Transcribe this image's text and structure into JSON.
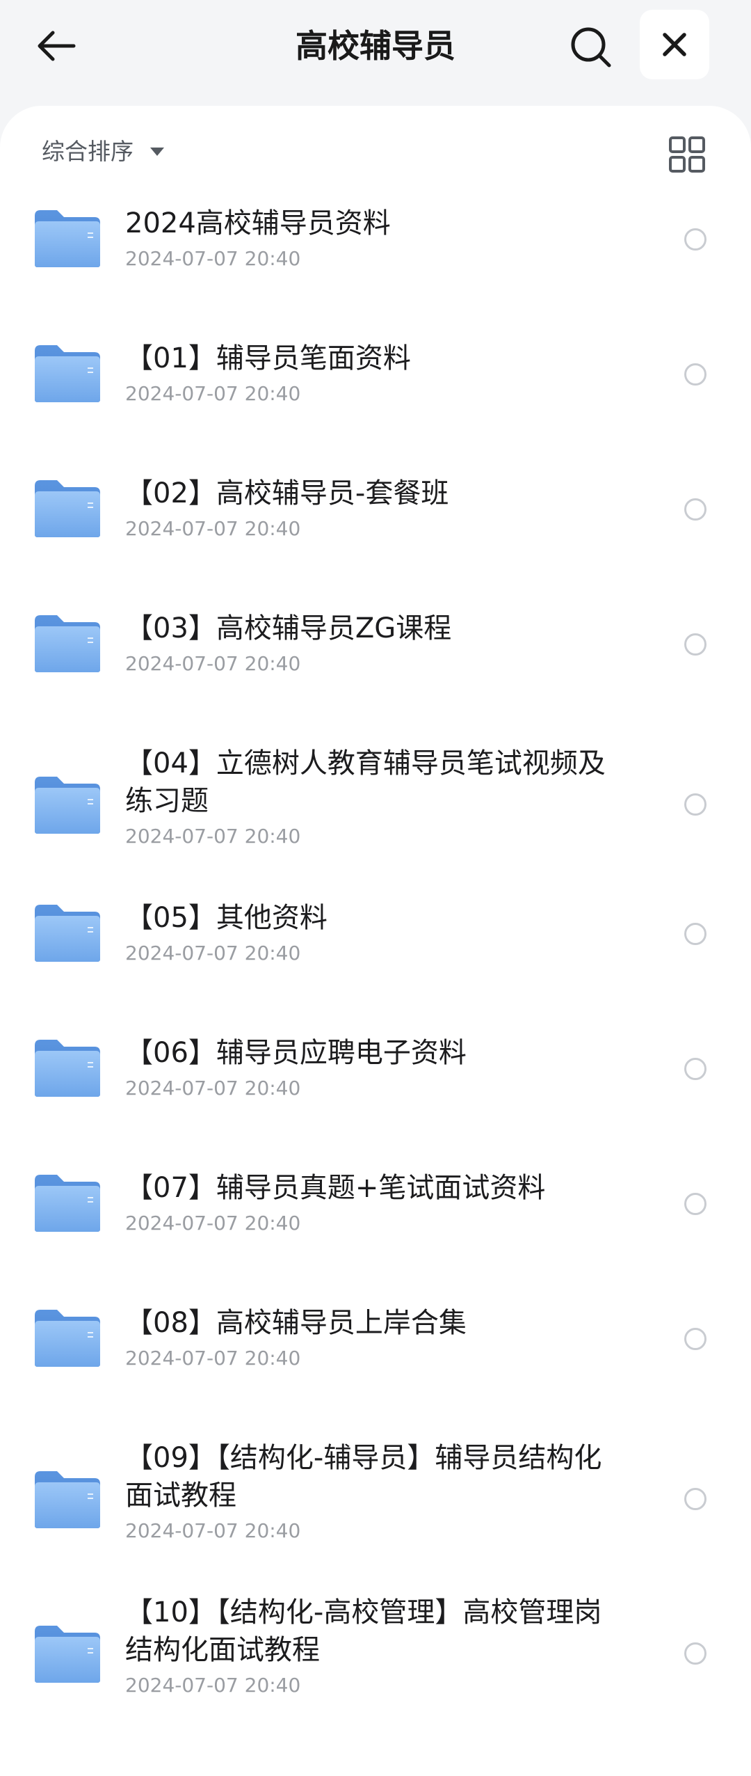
{
  "header": {
    "title": "高校辅导员",
    "back_icon": "arrow-left-icon",
    "search_icon": "search-icon",
    "close_icon": "close-icon"
  },
  "toolbar": {
    "sort_label": "综合排序",
    "sort_icon": "caret-down-icon",
    "view_icon": "grid-view-icon"
  },
  "colors": {
    "background": "#f4f5f7",
    "panel": "#ffffff",
    "folder": "#7fb3ef",
    "date_text": "#9a9da2"
  },
  "files": [
    {
      "name": "2024高校辅导员资料",
      "date": "2024-07-07 20:40"
    },
    {
      "name": "【01】辅导员笔面资料",
      "date": "2024-07-07 20:40"
    },
    {
      "name": "【02】高校辅导员-套餐班",
      "date": "2024-07-07 20:40"
    },
    {
      "name": "【03】高校辅导员ZG课程",
      "date": "2024-07-07 20:40"
    },
    {
      "name": "【04】立德树人教育辅导员笔试视频及练习题",
      "date": "2024-07-07 20:40"
    },
    {
      "name": "【05】其他资料",
      "date": "2024-07-07 20:40"
    },
    {
      "name": "【06】辅导员应聘电子资料",
      "date": "2024-07-07 20:40"
    },
    {
      "name": "【07】辅导员真题+笔试面试资料",
      "date": "2024-07-07 20:40"
    },
    {
      "name": "【08】高校辅导员上岸合集",
      "date": "2024-07-07 20:40"
    },
    {
      "name": "【09】【结构化-辅导员】辅导员结构化面试教程",
      "date": "2024-07-07 20:40"
    },
    {
      "name": "【10】【结构化-高校管理】高校管理岗结构化面试教程",
      "date": "2024-07-07 20:40"
    }
  ]
}
